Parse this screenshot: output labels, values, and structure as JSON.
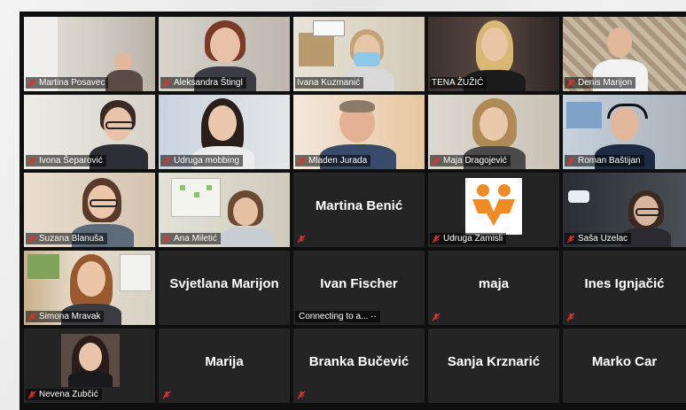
{
  "participants": [
    {
      "name": "Martina Posavec"
    },
    {
      "name": "Aleksandra Štingl"
    },
    {
      "name": "Ivana Kuzmanić"
    },
    {
      "name": "TENA ŽUŽIĆ"
    },
    {
      "name": "Denis Marijon"
    },
    {
      "name": "Ivona Šeparović"
    },
    {
      "name": "Udruga mobbing"
    },
    {
      "name": "Mladen Jurada"
    },
    {
      "name": "Maja Dragojević"
    },
    {
      "name": "Roman Baštijan"
    },
    {
      "name": "Suzana Blanuša"
    },
    {
      "name": "Ana Miletić"
    },
    {
      "name": "Martina Benić"
    },
    {
      "name": "Udruga Zamisli"
    },
    {
      "name": "Saša Uzelac"
    },
    {
      "name": "Simona Mravak"
    },
    {
      "name": "Svjetlana Marijon"
    },
    {
      "name": "Ivan Fischer",
      "status": "Connecting to a... ··"
    },
    {
      "name": "maja"
    },
    {
      "name": "Ines Ignjačić"
    },
    {
      "name": "Nevena Zubčić"
    },
    {
      "name": "Marija"
    },
    {
      "name": "Branka Bučević"
    },
    {
      "name": "Sanja Krznarić"
    },
    {
      "name": "Marko Car"
    }
  ],
  "colors": {
    "active_speaker_border": "#c9d64a",
    "muted_mic": "#e0302c",
    "zamisli_logo": "#f08a24"
  },
  "icons": {
    "muted": "mic-muted-icon"
  }
}
